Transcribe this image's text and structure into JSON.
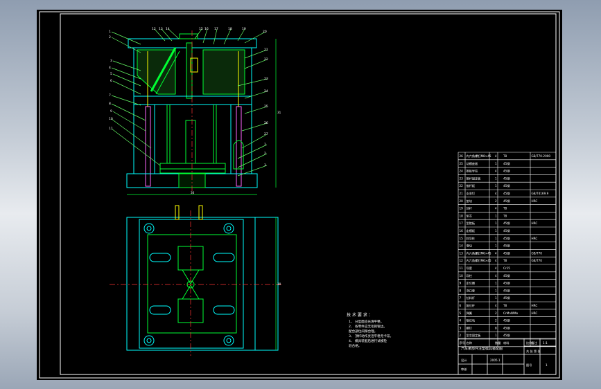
{
  "colors": {
    "background": "#000000",
    "border": "#ffffff",
    "mold_outline": "#00ffff",
    "component": "#00ff33",
    "leader": "#66ff66",
    "tie_rods": "#ff66ff",
    "fasteners": "#ffff00",
    "text": "#ffffff"
  },
  "front_view": {
    "width_dim": "30",
    "height_dim": "31",
    "balloons": [
      "1",
      "2",
      "3",
      "4",
      "5",
      "6",
      "7",
      "8",
      "9",
      "10",
      "11",
      "12",
      "13",
      "14",
      "15",
      "16",
      "17",
      "18",
      "19",
      "20",
      "21",
      "22",
      "23",
      "24",
      "25",
      "26",
      "27"
    ]
  },
  "top_view": {
    "height_dim": "30"
  },
  "tech_notes": {
    "heading": "技 术 要 求 ：",
    "lines": [
      "1、 分型面应光滑平整。",
      "2、 各零件应无毛刺锐边。",
      "   配合部位间隙合理。",
      "3、 顶杆动作灵活平稳无卡滞。",
      "4、 模具装配后进行试模检",
      "   验合格。"
    ]
  },
  "bom": {
    "rows": [
      {
        "no": "26",
        "name": "内六角螺钉M8×45",
        "qty": "4",
        "material": "T8",
        "remark": "GB/T70-2000"
      },
      {
        "no": "25",
        "name": "动模座板",
        "qty": "1",
        "material": "45钢",
        "remark": ""
      },
      {
        "no": "24",
        "name": "推板导柱",
        "qty": "4",
        "material": "45钢",
        "remark": ""
      },
      {
        "no": "23",
        "name": "推杆固定板",
        "qty": "1",
        "material": "45钢",
        "remark": ""
      },
      {
        "no": "22",
        "name": "推杆板",
        "qty": "1",
        "material": "45钢",
        "remark": ""
      },
      {
        "no": "21",
        "name": "支承钉",
        "qty": "4",
        "material": "45钢",
        "remark": "GB/T4169.9"
      },
      {
        "no": "20",
        "name": "垫块",
        "qty": "2",
        "material": "45钢",
        "remark": "HRC"
      },
      {
        "no": "19",
        "name": "顶杆",
        "qty": "4",
        "material": "T8",
        "remark": ""
      },
      {
        "no": "18",
        "name": "型芯",
        "qty": "1",
        "material": "T8",
        "remark": ""
      },
      {
        "no": "17",
        "name": "型腔板",
        "qty": "1",
        "material": "45钢",
        "remark": "HRC"
      },
      {
        "no": "16",
        "name": "定模板",
        "qty": "1",
        "material": "45钢",
        "remark": ""
      },
      {
        "no": "15",
        "name": "斜导柱",
        "qty": "1",
        "material": "45钢",
        "remark": "HRC"
      },
      {
        "no": "14",
        "name": "滑块",
        "qty": "1",
        "material": "45钢",
        "remark": ""
      },
      {
        "no": "13",
        "name": "内六角螺钉M6×45",
        "qty": "4",
        "material": "45钢",
        "remark": "GB/T70"
      },
      {
        "no": "12",
        "name": "内六角螺钉M6×45",
        "qty": "4",
        "material": "T8",
        "remark": "GB/T70"
      },
      {
        "no": "11",
        "name": "导套",
        "qty": "4",
        "material": "Cr15",
        "remark": ""
      },
      {
        "no": "10",
        "name": "导柱",
        "qty": "4",
        "material": "45钢",
        "remark": ""
      },
      {
        "no": "9",
        "name": "定位圈",
        "qty": "1",
        "material": "45钢",
        "remark": ""
      },
      {
        "no": "8",
        "name": "浇口套",
        "qty": "1",
        "material": "45钢",
        "remark": ""
      },
      {
        "no": "7",
        "name": "拉料杆",
        "qty": "1",
        "material": "45钢",
        "remark": ""
      },
      {
        "no": "6",
        "name": "复位杆",
        "qty": "4",
        "material": "T8",
        "remark": "HRC"
      },
      {
        "no": "5",
        "name": "弹簧",
        "qty": "2",
        "material": "CrMnWMo",
        "remark": "HRC"
      },
      {
        "no": "4",
        "name": "限位块",
        "qty": "2",
        "material": "45钢",
        "remark": ""
      },
      {
        "no": "3",
        "name": "螺钉",
        "qty": "8",
        "material": "45钢",
        "remark": ""
      },
      {
        "no": "2",
        "name": "型芯固定板",
        "qty": "1",
        "material": "45钢",
        "remark": ""
      }
    ],
    "header": {
      "no": "序号",
      "name": "名称",
      "qty": "数量",
      "material": "材料",
      "remark": "备注"
    }
  },
  "title_block": {
    "title": "汽车某部件注塑模具装配图",
    "scale_label": "比例",
    "scale": "1:1",
    "designer_label": "设计",
    "date": "2005.1",
    "checker_label": "审核",
    "sheet_label": "共 张 第 张",
    "drawing_label": "图号",
    "drawing_no": "1"
  }
}
